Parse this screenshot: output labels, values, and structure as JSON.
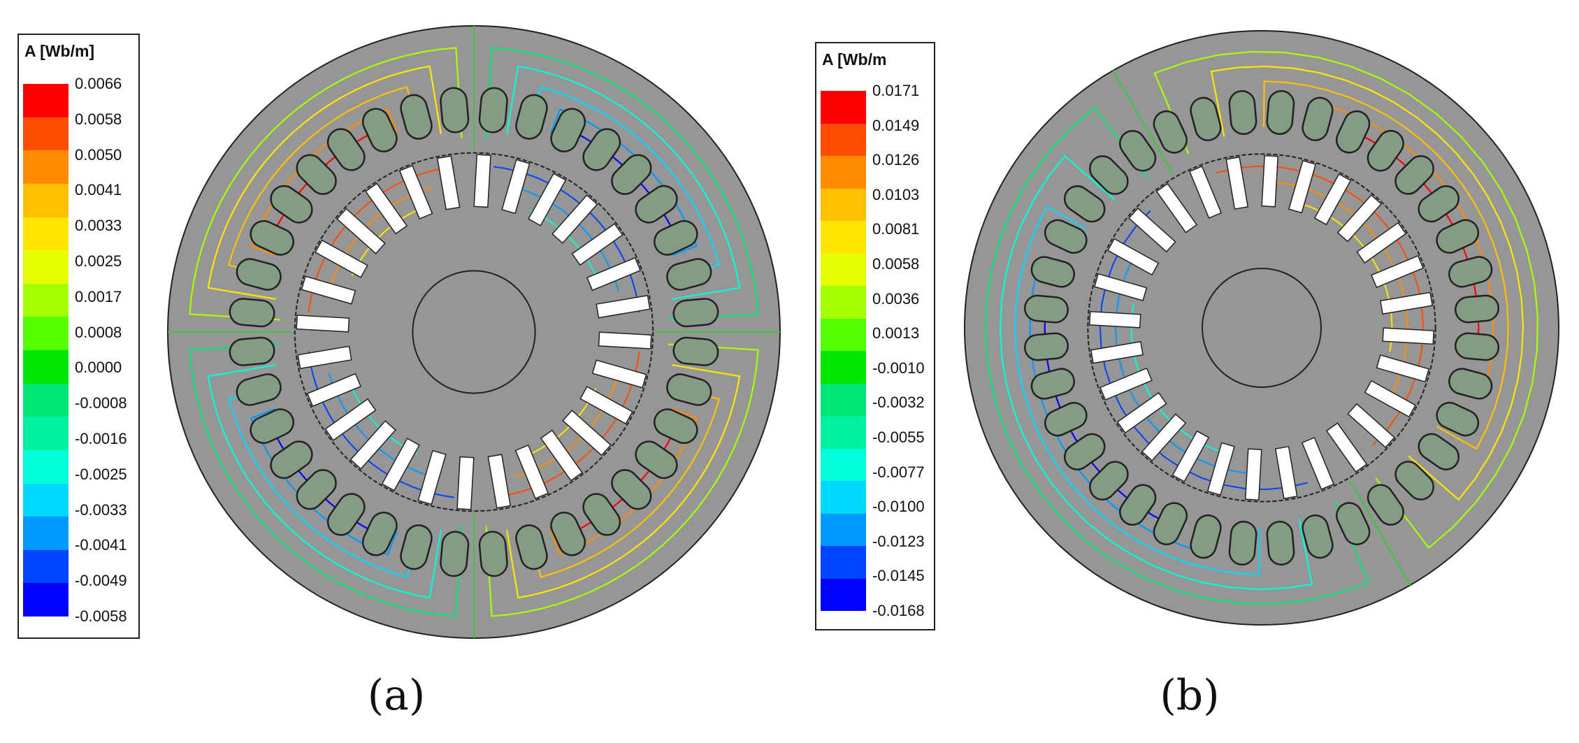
{
  "figures": [
    {
      "id": "a",
      "caption": "(a)",
      "legend": {
        "title": "A [Wb/m]",
        "labels": [
          "0.0066",
          "0.0058",
          "0.0050",
          "0.0041",
          "0.0033",
          "0.0025",
          "0.0017",
          "0.0008",
          "0.0000",
          "-0.0008",
          "-0.0016",
          "-0.0025",
          "-0.0033",
          "-0.0041",
          "-0.0049",
          "-0.0058"
        ]
      },
      "motor": {
        "stator_slots": 36,
        "rotor_slots": 28,
        "poles": 4
      }
    },
    {
      "id": "b",
      "caption": "(b)",
      "legend": {
        "title": "A [Wb/m",
        "labels": [
          "0.0171",
          "0.0149",
          "0.0126",
          "0.0103",
          "0.0081",
          "0.0058",
          "0.0036",
          "0.0013",
          "-0.0010",
          "-0.0032",
          "-0.0055",
          "-0.0077",
          "-0.0100",
          "-0.0123",
          "-0.0145",
          "-0.0168"
        ]
      },
      "motor": {
        "stator_slots": 36,
        "rotor_slots": 28,
        "poles": 2
      }
    }
  ],
  "colors": {
    "scale": [
      "#ff0000",
      "#ff4d00",
      "#ff8c00",
      "#ffc000",
      "#ffe600",
      "#e6ff00",
      "#a6ff00",
      "#55ff00",
      "#00e600",
      "#00e676",
      "#00f0a0",
      "#00ffd8",
      "#00d8ff",
      "#0099ff",
      "#0044ff",
      "#0000ff"
    ],
    "iron": "#969696",
    "stator_slot": "#859c84",
    "rotor_bar": "#ffffff",
    "outline": "#222222"
  }
}
